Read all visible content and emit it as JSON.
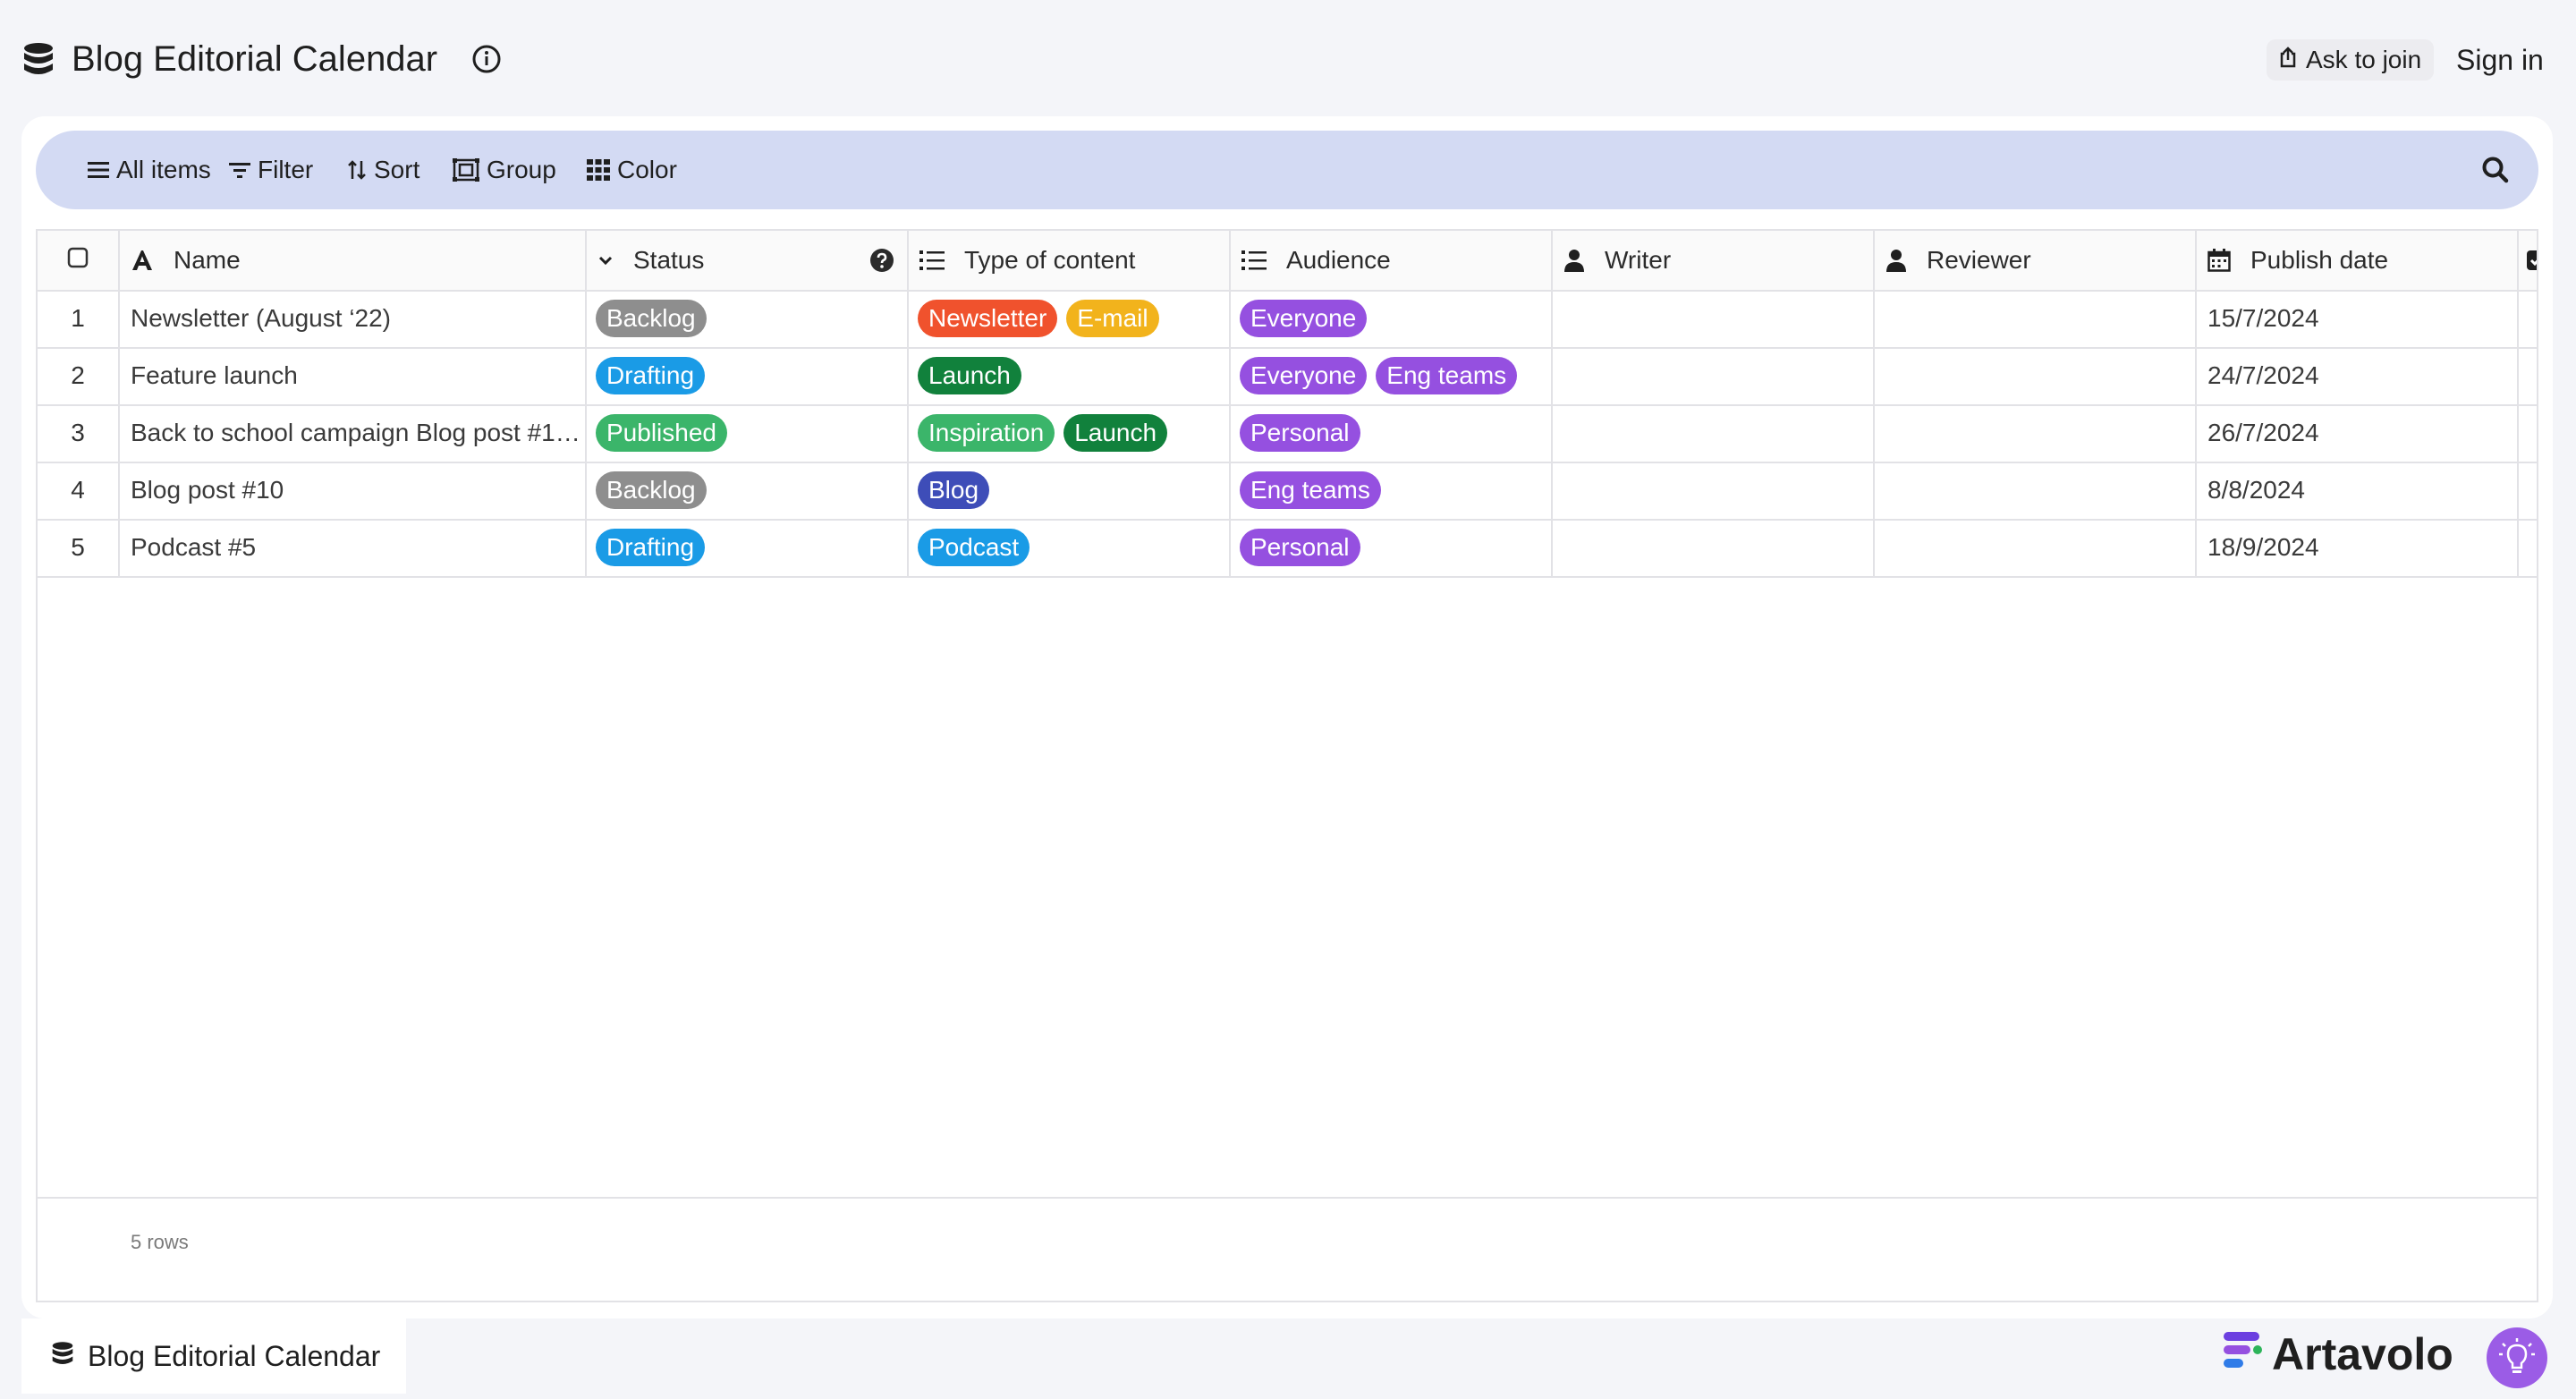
{
  "app": {
    "title": "Blog Editorial Calendar",
    "ask_to_join": "Ask to join",
    "sign_in": "Sign in"
  },
  "toolbar": {
    "all_items": "All items",
    "filter": "Filter",
    "sort": "Sort",
    "group": "Group",
    "color": "Color"
  },
  "columns": {
    "name": "Name",
    "status": "Status",
    "type": "Type of content",
    "audience": "Audience",
    "writer": "Writer",
    "reviewer": "Reviewer",
    "publish_date": "Publish date"
  },
  "rows": [
    {
      "num": "1",
      "name": "Newsletter (August ‘22)",
      "status": "Backlog",
      "types": [
        "Newsletter",
        "E-mail"
      ],
      "audience": [
        "Everyone"
      ],
      "writer": "",
      "reviewer": "",
      "date": "15/7/2024"
    },
    {
      "num": "2",
      "name": "Feature launch",
      "status": "Drafting",
      "types": [
        "Launch"
      ],
      "audience": [
        "Everyone",
        "Eng teams"
      ],
      "writer": "",
      "reviewer": "",
      "date": "24/7/2024"
    },
    {
      "num": "3",
      "name": "Back to school campaign Blog post #1…",
      "status": "Published",
      "types": [
        "Inspiration",
        "Launch"
      ],
      "audience": [
        "Personal"
      ],
      "writer": "",
      "reviewer": "",
      "date": "26/7/2024"
    },
    {
      "num": "4",
      "name": "Blog post #10",
      "status": "Backlog",
      "types": [
        "Blog"
      ],
      "audience": [
        "Eng teams"
      ],
      "writer": "",
      "reviewer": "",
      "date": "8/8/2024"
    },
    {
      "num": "5",
      "name": "Podcast #5",
      "status": "Drafting",
      "types": [
        "Podcast"
      ],
      "audience": [
        "Personal"
      ],
      "writer": "",
      "reviewer": "",
      "date": "18/9/2024"
    }
  ],
  "row_count": "5 rows",
  "bottom_tab": "Blog Editorial Calendar",
  "brand": "Artavolo",
  "tag_colors": {
    "Backlog": "#8e8e8e",
    "Drafting": "#1a9be6",
    "Published": "#3bb56a",
    "Newsletter": "#f0522d",
    "E-mail": "#f2b31c",
    "Launch": "#11813c",
    "Inspiration": "#3bb56a",
    "Blog": "#3e4db8",
    "Podcast": "#1a9be6",
    "Everyone": "#9550e0",
    "Eng teams": "#9550e0",
    "Personal": "#9550e0"
  }
}
